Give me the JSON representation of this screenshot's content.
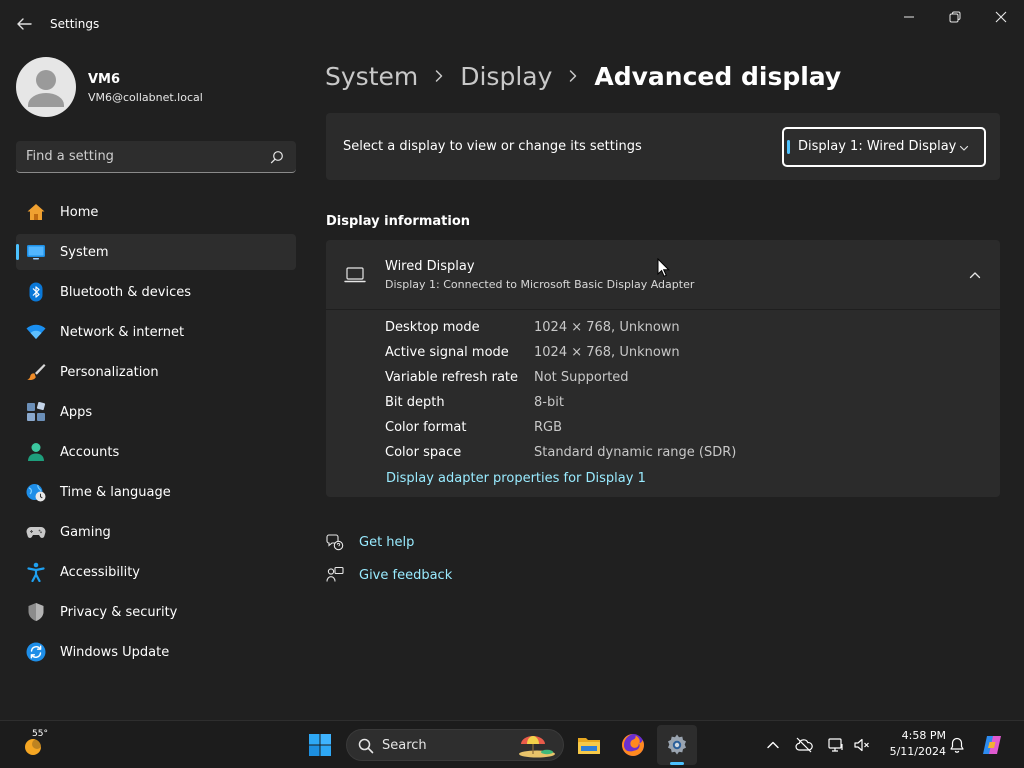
{
  "window": {
    "app_title": "Settings"
  },
  "profile": {
    "name": "VM6",
    "email": "VM6@collabnet.local"
  },
  "search": {
    "placeholder": "Find a setting"
  },
  "nav": {
    "items": [
      {
        "label": "Home",
        "icon": "home-icon"
      },
      {
        "label": "System",
        "icon": "system-icon",
        "selected": true
      },
      {
        "label": "Bluetooth & devices",
        "icon": "bluetooth-icon"
      },
      {
        "label": "Network & internet",
        "icon": "wifi-icon"
      },
      {
        "label": "Personalization",
        "icon": "brush-icon"
      },
      {
        "label": "Apps",
        "icon": "apps-icon"
      },
      {
        "label": "Accounts",
        "icon": "accounts-icon"
      },
      {
        "label": "Time & language",
        "icon": "globe-clock-icon"
      },
      {
        "label": "Gaming",
        "icon": "gamepad-icon"
      },
      {
        "label": "Accessibility",
        "icon": "accessibility-icon"
      },
      {
        "label": "Privacy & security",
        "icon": "shield-icon"
      },
      {
        "label": "Windows Update",
        "icon": "update-icon"
      }
    ]
  },
  "breadcrumb": {
    "items": [
      "System",
      "Display",
      "Advanced display"
    ]
  },
  "display_select": {
    "prompt": "Select a display to view or change its settings",
    "selected": "Display 1: Wired Display"
  },
  "display_info": {
    "heading": "Display information",
    "name": "Wired Display",
    "subtitle": "Display 1: Connected to Microsoft Basic Display Adapter",
    "rows": [
      {
        "label": "Desktop mode",
        "value": "1024 × 768, Unknown"
      },
      {
        "label": "Active signal mode",
        "value": "1024 × 768, Unknown"
      },
      {
        "label": "Variable refresh rate",
        "value": "Not Supported"
      },
      {
        "label": "Bit depth",
        "value": "8-bit"
      },
      {
        "label": "Color format",
        "value": "RGB"
      },
      {
        "label": "Color space",
        "value": "Standard dynamic range (SDR)"
      }
    ],
    "adapter_link": "Display adapter properties for Display 1"
  },
  "help": {
    "get_help": "Get help",
    "give_feedback": "Give feedback"
  },
  "taskbar": {
    "weather_temp": "55°",
    "search_label": "Search",
    "time": "4:58 PM",
    "date": "5/11/2024"
  },
  "colors": {
    "accent": "#4cc2ff",
    "link": "#99ebff",
    "background": "#202020",
    "card": "#2b2b2b"
  }
}
